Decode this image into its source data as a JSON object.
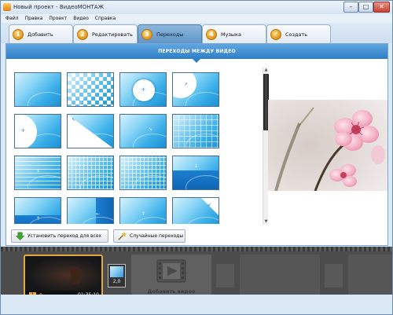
{
  "window": {
    "title": "Новый проект - ВидеоМОНТАЖ",
    "minimize_glyph": "–",
    "maximize_glyph": "□",
    "close_glyph": "✕"
  },
  "menu": [
    "Файл",
    "Правка",
    "Проект",
    "Видео",
    "Справка"
  ],
  "tabs": [
    {
      "num": "1",
      "label": "Добавить",
      "active": false
    },
    {
      "num": "2",
      "label": "Редактировать",
      "active": false
    },
    {
      "num": "3",
      "label": "Переходы",
      "active": true
    },
    {
      "num": "4",
      "label": "Музыка",
      "active": false
    },
    {
      "num": "✓",
      "label": "Создать",
      "active": false
    }
  ],
  "transitions": {
    "header": "ПЕРЕХОДЫ МЕЖДУ ВИДЕО",
    "items": [
      {
        "style": "plain"
      },
      {
        "style": "checker"
      },
      {
        "style": "circle"
      },
      {
        "style": "moon"
      },
      {
        "style": "bigcircle"
      },
      {
        "style": "diag"
      },
      {
        "style": "plain"
      },
      {
        "style": "hlines"
      },
      {
        "style": "hlines"
      },
      {
        "style": "grid"
      },
      {
        "style": "grid2"
      },
      {
        "style": "split"
      },
      {
        "style": "split2"
      },
      {
        "style": "vsplit"
      },
      {
        "style": "plain"
      },
      {
        "style": "corner"
      }
    ]
  },
  "buttons": {
    "apply_all": "Установить переход для всех",
    "random": "Случайные переходы"
  },
  "timeline": {
    "clip": {
      "index": "1",
      "duration": "01:35:10"
    },
    "transition_duration": "2,0",
    "add_video_label": "Добавить видео"
  },
  "colors": {
    "accent": "#2e7fc8",
    "clip_border": "#e7a83a",
    "timeline_bg": "#4c4c4c"
  }
}
